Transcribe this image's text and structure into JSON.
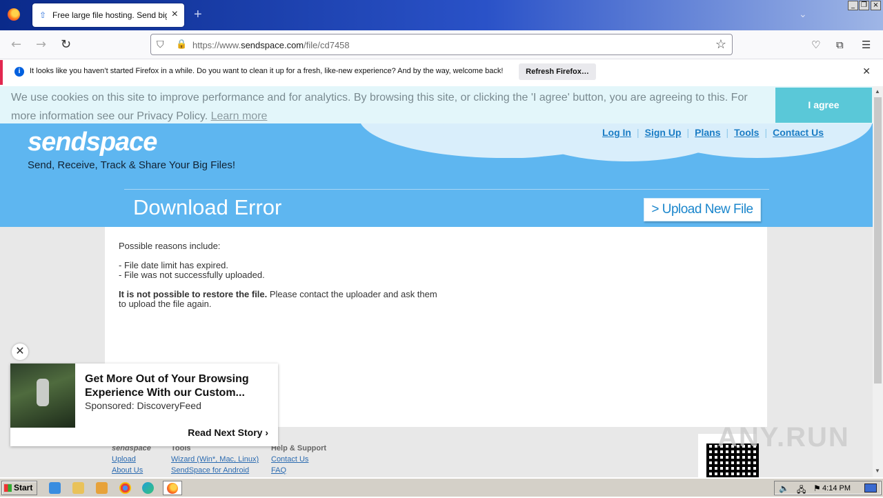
{
  "browser": {
    "tab_title": "Free large file hosting. Send big file",
    "url_prefix": "https://www.",
    "url_domain": "sendspace.com",
    "url_path": "/file/cd7458",
    "notification_text": "It looks like you haven’t started Firefox in a while. Do you want to clean it up for a fresh, like-new experience? And by the way, welcome back!",
    "notification_button": "Refresh Firefox…"
  },
  "cookie": {
    "text": "We use cookies on this site to improve performance and for analytics. By browsing this site, or clicking the 'I agree' button, you are agreeing to this. For more information see our Privacy Policy.",
    "learn_more": "Learn more",
    "agree": "I agree"
  },
  "site": {
    "logo": "sendspace",
    "tagline": "Send, Receive, Track & Share Your Big Files!",
    "nav": [
      "Log In",
      "Sign Up",
      "Plans",
      "Tools",
      "Contact Us"
    ],
    "page_title": "Download Error",
    "upload_button": "> Upload New File"
  },
  "content": {
    "intro": "Possible reasons include:",
    "reason1": "- File date limit has expired.",
    "reason2": "- File was not successfully uploaded.",
    "bold_line": "It is not possible to restore the file.",
    "rest_line1": " Please contact the uploader and ask them",
    "rest_line2": "to upload the file again."
  },
  "footer": {
    "col1": {
      "heading": "sendspace",
      "links": [
        "Upload",
        "About Us"
      ]
    },
    "col2": {
      "heading": "Tools",
      "links": [
        "Wizard (Win*, Mac, Linux)",
        "SendSpace for Android"
      ]
    },
    "col3": {
      "heading": "Help & Support",
      "links": [
        "Contact Us",
        "FAQ"
      ]
    }
  },
  "ad": {
    "headline": "Get More Out of Your Browsing Experience With our Custom...",
    "sponsor": "Sponsored: DiscoveryFeed",
    "cta": "Read Next Story"
  },
  "watermark": "ANY.RUN",
  "taskbar": {
    "start": "Start",
    "clock": "4:14 PM"
  },
  "colors": {
    "hero": "#5eb6f0",
    "accent_link": "#1a7cc4",
    "agree_button": "#5ac8d8"
  }
}
